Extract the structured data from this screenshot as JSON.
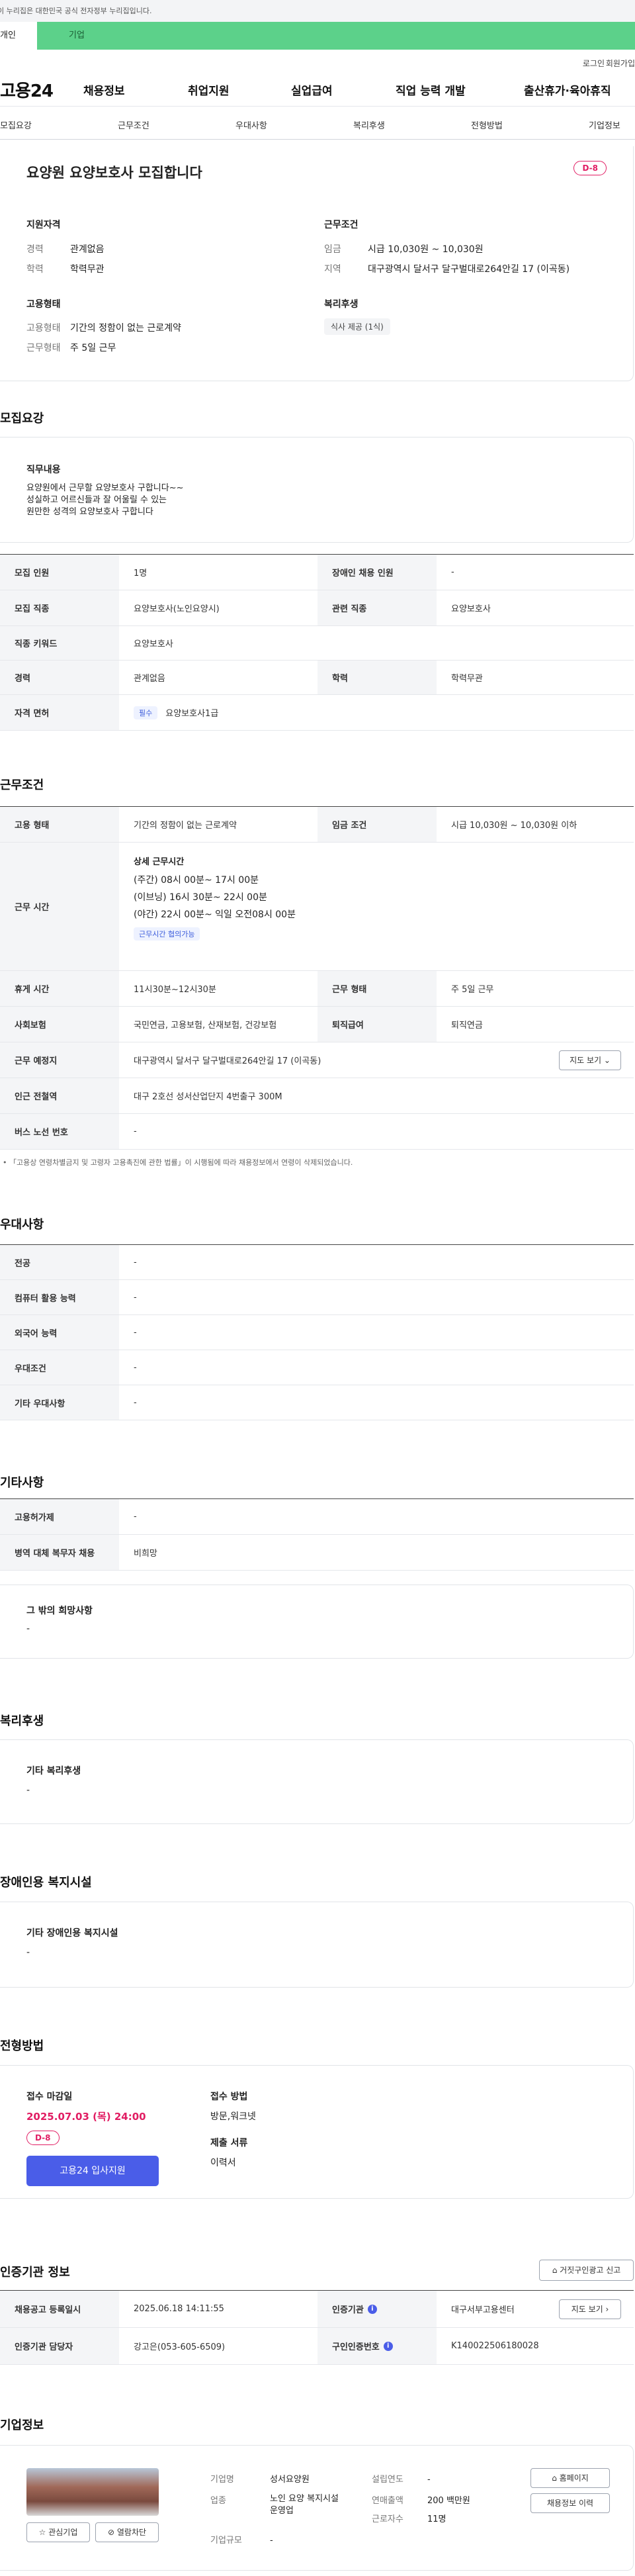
{
  "top_notice": "이 누리집은 대한민국 공식 전자정부 누리집입니다.",
  "user_tabs": [
    "개인",
    "기업"
  ],
  "util": {
    "login": "로그인",
    "join": "회원가입"
  },
  "gnb": {
    "logo": "고용24",
    "menus": [
      "채용정보",
      "취업지원",
      "실업급여",
      "직업 능력 개발",
      "출산휴가·육아휴직"
    ]
  },
  "subnav": [
    "모집요강",
    "근무조건",
    "우대사항",
    "복리후생",
    "전형방법",
    "기업정보"
  ],
  "summary": {
    "title": "요양원 요양보호사 모집합니다",
    "dday": "D-8",
    "qual_title": "지원자격",
    "qual": [
      {
        "k": "경력",
        "v": "관계없음"
      },
      {
        "k": "학력",
        "v": "학력무관"
      }
    ],
    "cond_title": "근무조건",
    "cond": [
      {
        "k": "임금",
        "v": "시급 10,030원 ~ 10,030원"
      },
      {
        "k": "지역",
        "v": "대구광역시 달서구 달구벌대로264안길 17 (이곡동)"
      }
    ],
    "emp_title": "고용형태",
    "emp": [
      {
        "k": "고용형태",
        "v": "기간의 정함이 없는 근로계약"
      },
      {
        "k": "근무형태",
        "v": "주 5일 근무"
      }
    ],
    "welfare_title": "복리후생",
    "welfare_tag": "식사 제공 (1식)"
  },
  "recruit": {
    "title": "모집요강",
    "duty_label": "직무내용",
    "duty_lines": [
      "요양원에서 근무할 요양보호사 구합니다~~",
      "성실하고 어르신들과 잘 어울릴 수 있는",
      "원만한 성격의 요양보호사 구합니다"
    ],
    "rows": [
      {
        "h1": "모집 인원",
        "v1": "1명",
        "h2": "장애인 채용 인원",
        "v2": "-"
      },
      {
        "h1": "모집 직종",
        "v1": "요양보호사(노인요양시)",
        "h2": "관련 직종",
        "v2": "요양보호사"
      },
      {
        "h1": "직종 키워드",
        "v1": "요양보호사"
      },
      {
        "h1": "경력",
        "v1": "관계없음",
        "h2": "학력",
        "v2": "학력무관"
      },
      {
        "h1": "자격 면허",
        "tag": "필수",
        "v1": "요양보호사1급"
      }
    ]
  },
  "work": {
    "title": "근무조건",
    "row1": {
      "h1": "고용 형태",
      "v1": "기간의 정함이 없는 근로계약",
      "h2": "임금 조건",
      "v2": "시급 10,030원 ~ 10,030원 이하"
    },
    "time": {
      "h": "근무 시간",
      "sub": "상세 근무시간",
      "lines": [
        "(주간)    08시 00분~ 17시 00분",
        "(이브닝) 16시 30분~ 22시 00분",
        "(야간)    22시 00분~ 익일 오전08시 00분"
      ],
      "tag": "근무시간 협의가능"
    },
    "row3": {
      "h1": "휴게 시간",
      "v1": "11시30분~12시30분",
      "h2": "근무 형태",
      "v2": "주 5일 근무"
    },
    "row4": {
      "h1": "사회보험",
      "v1": "국민연금, 고용보험, 산재보험, 건강보험",
      "h2": "퇴직급여",
      "v2": "퇴직연금"
    },
    "row5": {
      "h1": "근무 예정지",
      "v1": "대구광역시 달서구 달구벌대로264안길 17 (이곡동)",
      "btn": "지도 보기"
    },
    "row6": {
      "h1": "인근 전철역",
      "v1": "대구 2호선 성서산업단지 4번출구 300M"
    },
    "row7": {
      "h1": "버스 노선 번호",
      "v1": "-"
    },
    "note": "「고용상 연령차별금지 및 고령자 고용촉진에 관한 법률」이 시행됨에 따라 채용정보에서 연령이 삭제되었습니다."
  },
  "pref": {
    "title": "우대사항",
    "rows": [
      {
        "h": "전공",
        "v": "-"
      },
      {
        "h": "컴퓨터 활용 능력",
        "v": "-"
      },
      {
        "h": "외국어 능력",
        "v": "-"
      },
      {
        "h": "우대조건",
        "v": "-"
      },
      {
        "h": "기타 우대사항",
        "v": "-"
      }
    ]
  },
  "etc": {
    "title": "기타사항",
    "rows": [
      {
        "h": "고용허가제",
        "v": "-"
      },
      {
        "h": "병역 대체 복무자 채용",
        "v": "비희망"
      }
    ],
    "other_label": "그 밖의 희망사항",
    "other_value": "-"
  },
  "welfare": {
    "title": "복리후생",
    "label": "기타 복리후생",
    "value": "-"
  },
  "disability": {
    "title": "장애인용 복지시설",
    "label": "기타 장애인용 복지시설",
    "value": "-"
  },
  "process": {
    "title": "전형방법",
    "deadline_label": "접수 마감일",
    "deadline": "2025.07.03 (목) 24:00",
    "dday": "D-8",
    "apply_btn": "고용24 입사지원",
    "method_label": "접수 방법",
    "method": "방문,워크넷",
    "docs_label": "제출 서류",
    "docs": "이력서"
  },
  "cert": {
    "title": "인증기관 정보",
    "report_btn": "거짓구인광고 신고",
    "rows": [
      {
        "h1": "채용공고 등록일시",
        "v1": "2025.06.18 14:11:55",
        "h2": "인증기관",
        "v2": "대구서부고용센터",
        "btn": "지도 보기"
      },
      {
        "h1": "인증기관 담당자",
        "v1": "강고은(053-605-6509)",
        "h2": "구인인증번호",
        "v2": "K140022506180028"
      }
    ]
  },
  "company": {
    "title": "기업정보",
    "fav_btn": "관심기업",
    "block_btn": "열람차단",
    "fields": [
      {
        "k": "기업명",
        "v": "성서요양원"
      },
      {
        "k": "업종",
        "v": "노인 요양 복지시설 운영업"
      },
      {
        "k": "기업규모",
        "v": "-"
      },
      {
        "k": "설립연도",
        "v": "-"
      },
      {
        "k": "연매출액",
        "v": "200 백만원"
      },
      {
        "k": "근로자수",
        "v": "11명"
      }
    ],
    "home_btn": "홈페이지",
    "history_btn": "채용정보 이력"
  },
  "colors": {
    "green": "#5cd18a",
    "pink": "#e11d63",
    "blue": "#4a5de8"
  }
}
